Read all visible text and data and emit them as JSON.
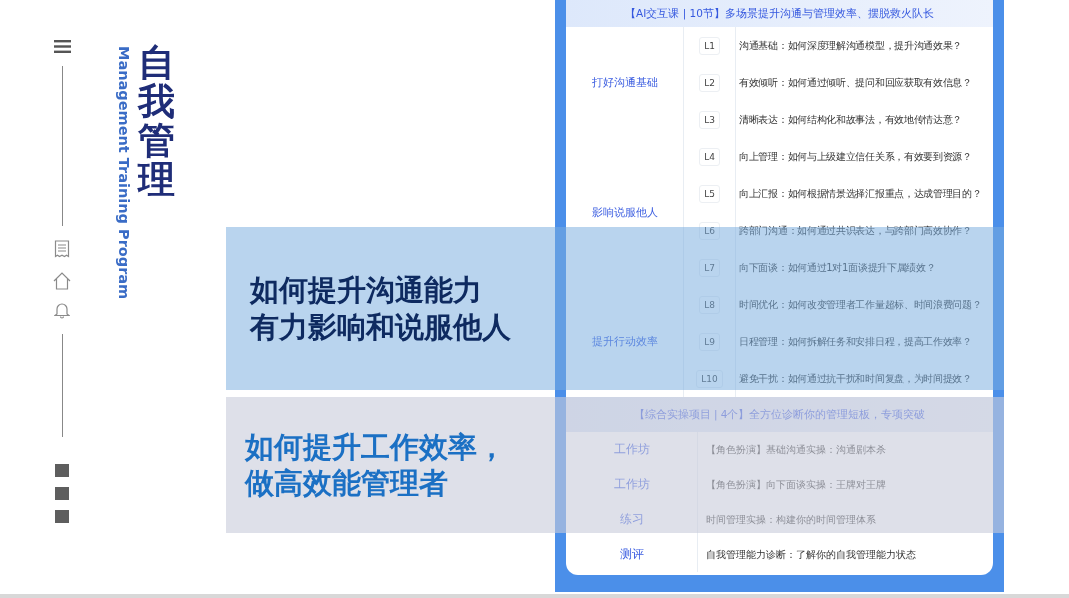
{
  "title": "自我管理",
  "subtitle": "Management Training Program",
  "course": {
    "sections": [
      {
        "kind": "lessons",
        "header": "【AI交互课 | 10节】多场景提升沟通与管理效率、摆脱救火队长",
        "groups": [
          {
            "name": "打好沟通基础",
            "lessons": [
              {
                "code": "L1",
                "text": "沟通基础：如何深度理解沟通模型，提升沟通效果？"
              },
              {
                "code": "L2",
                "text": "有效倾听：如何通过倾听、提问和回应获取有效信息？"
              },
              {
                "code": "L3",
                "text": "清晰表达：如何结构化和故事法，有效地传情达意？"
              }
            ]
          },
          {
            "name": "影响说服他人",
            "lessons": [
              {
                "code": "L4",
                "text": "向上管理：如何与上级建立信任关系，有效要到资源？"
              },
              {
                "code": "L5",
                "text": "向上汇报：如何根据情景选择汇报重点，达成管理目的？"
              },
              {
                "code": "L6",
                "text": "跨部门沟通：如何通过共识表达，与跨部门高效协作？"
              },
              {
                "code": "L7",
                "text": "向下面谈：如何通过1对1面谈提升下属绩效？"
              }
            ]
          },
          {
            "name": "提升行动效率",
            "lessons": [
              {
                "code": "L8",
                "text": "时间优化：如何改变管理者工作量超标、时间浪费问题？"
              },
              {
                "code": "L9",
                "text": "日程管理：如何拆解任务和安排日程，提高工作效率？"
              },
              {
                "code": "L10",
                "text": "避免干扰：如何通过抗干扰和时间复盘，为时间提效？"
              }
            ]
          }
        ]
      },
      {
        "kind": "projects",
        "header": "【综合实操项目 | 4个】全方位诊断你的管理短板，专项突破",
        "rows": [
          {
            "type": "工作坊",
            "text": "【角色扮演】基础沟通实操：沟通剧本杀"
          },
          {
            "type": "工作坊",
            "text": "【角色扮演】向下面谈实操：王牌对王牌"
          },
          {
            "type": "练习",
            "text": "时间管理实操：构建你的时间管理体系"
          },
          {
            "type": "测评",
            "text": "自我管理能力诊断：了解你的自我管理能力状态"
          }
        ]
      }
    ]
  },
  "highlights": [
    {
      "kind": "primary",
      "lines": [
        "如何提升沟通能力",
        "有力影响和说服他人"
      ]
    },
    {
      "kind": "secondary",
      "lines": [
        "如何提升工作效率，",
        "做高效能管理者"
      ]
    }
  ]
}
